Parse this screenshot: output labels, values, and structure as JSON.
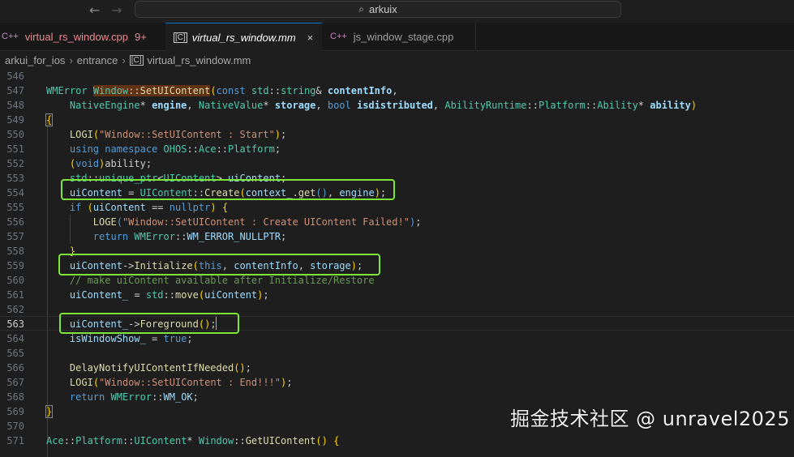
{
  "search": {
    "text": "arkuix"
  },
  "tabs": [
    {
      "label": "virtual_rs_window.cpp",
      "badge": "9+",
      "icon": "cpp-file-icon"
    },
    {
      "label": "virtual_rs_window.mm",
      "icon": "objc-file-icon",
      "close": "×"
    },
    {
      "label": "js_window_stage.cpp",
      "icon": "cpp-file-icon"
    }
  ],
  "breadcrumb": [
    "arkui_for_ios",
    "entrance",
    "virtual_rs_window.mm"
  ],
  "editor": {
    "current_line": 563,
    "lines": [
      {
        "num": "546",
        "code": ""
      },
      {
        "num": "547",
        "code": "WMError Window::SetUIContent(const std::string& contentInfo,"
      },
      {
        "num": "548",
        "code": "    NativeEngine* engine, NativeValue* storage, bool isdistributed, AbilityRuntime::Platform::Ability* ability)"
      },
      {
        "num": "549",
        "code": "{"
      },
      {
        "num": "550",
        "code": "    LOGI(\"Window::SetUIContent : Start\");"
      },
      {
        "num": "551",
        "code": "    using namespace OHOS::Ace::Platform;"
      },
      {
        "num": "552",
        "code": "    (void)ability;"
      },
      {
        "num": "553",
        "code": "    std::unique_ptr<UIContent> uiContent;"
      },
      {
        "num": "554",
        "code": "    uiContent = UIContent::Create(context_.get(), engine);"
      },
      {
        "num": "555",
        "code": "    if (uiContent == nullptr) {"
      },
      {
        "num": "556",
        "code": "        LOGE(\"Window::SetUIContent : Create UIContent Failed!\");"
      },
      {
        "num": "557",
        "code": "        return WMError::WM_ERROR_NULLPTR;"
      },
      {
        "num": "558",
        "code": "    }"
      },
      {
        "num": "559",
        "code": "    uiContent->Initialize(this, contentInfo, storage);"
      },
      {
        "num": "560",
        "code": "    // make uiContent available after Initialize/Restore"
      },
      {
        "num": "561",
        "code": "    uiContent_ = std::move(uiContent);"
      },
      {
        "num": "562",
        "code": ""
      },
      {
        "num": "563",
        "code": "    uiContent_->Foreground();"
      },
      {
        "num": "564",
        "code": "    isWindowShow_ = true;"
      },
      {
        "num": "565",
        "code": ""
      },
      {
        "num": "566",
        "code": "    DelayNotifyUIContentIfNeeded();"
      },
      {
        "num": "567",
        "code": "    LOGI(\"Window::SetUIContent : End!!!\");"
      },
      {
        "num": "568",
        "code": "    return WMError::WM_OK;"
      },
      {
        "num": "569",
        "code": "}"
      },
      {
        "num": "570",
        "code": ""
      },
      {
        "num": "571",
        "code": "Ace::Platform::UIContent* Window::GetUIContent() {"
      }
    ]
  },
  "colors": {
    "highlight_box": "#7ee63b",
    "accent": "#0078d4"
  },
  "watermark": "掘金技术社区 @ unravel2025"
}
